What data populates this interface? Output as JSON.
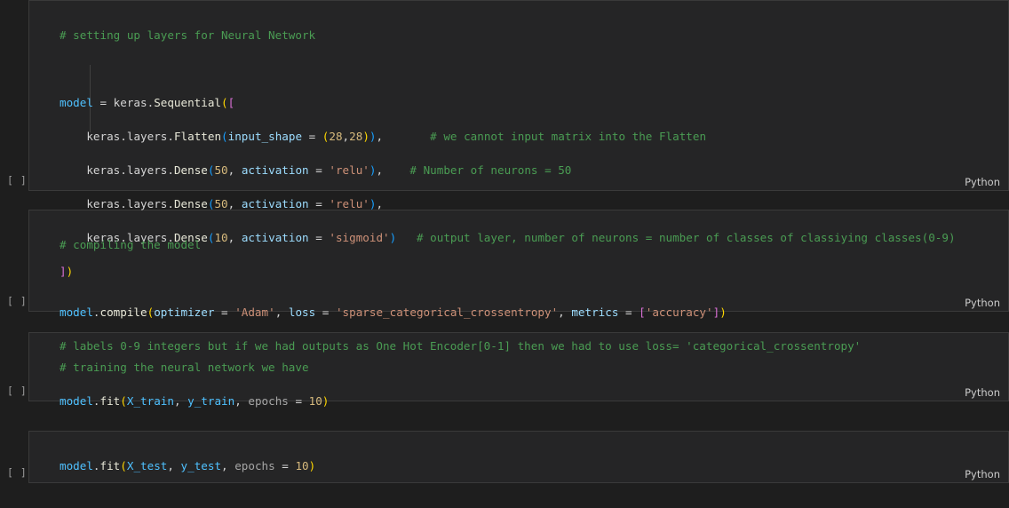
{
  "editor": {
    "background": "#1e1e1e",
    "cell_background": "#252526",
    "cell_border": "#3a3a3a",
    "language_label": "Python",
    "run_indicator": "[ ]"
  },
  "cells": [
    {
      "id": "cell-1",
      "language": "Python",
      "run_indicator": "[ ]",
      "source": [
        "# setting up layers for Neural Network",
        "",
        "model = keras.Sequential([",
        "    keras.layers.Flatten(input_shape = (28,28)),       # we cannot input matrix into the Flatten",
        "    keras.layers.Dense(50, activation = 'relu'),    # Number of neurons = 50",
        "    keras.layers.Dense(50, activation = 'relu'),",
        "    keras.layers.Dense(10, activation = 'sigmoid')   # output layer, number of neurons = number of classes of classiying classes(0-9)",
        "])"
      ]
    },
    {
      "id": "cell-2",
      "language": "Python",
      "run_indicator": "[ ]",
      "source": [
        "# compiling the model",
        "",
        "model.compile(optimizer = 'Adam', loss = 'sparse_categorical_crossentropy', metrics = ['accuracy'])",
        "# labels 0-9 integers but if we had outputs as One Hot Encoder[0-1] then we had to use loss= 'categorical_crossentropy'"
      ]
    },
    {
      "id": "cell-3",
      "language": "Python",
      "run_indicator": "[ ]",
      "source": [
        "# training the neural network we have",
        "model.fit(X_train, y_train, epochs = 10)"
      ]
    },
    {
      "id": "cell-4",
      "language": "Python",
      "run_indicator": "[ ]",
      "source": [
        "model.fit(X_test, y_test, epochs = 10)"
      ]
    }
  ]
}
